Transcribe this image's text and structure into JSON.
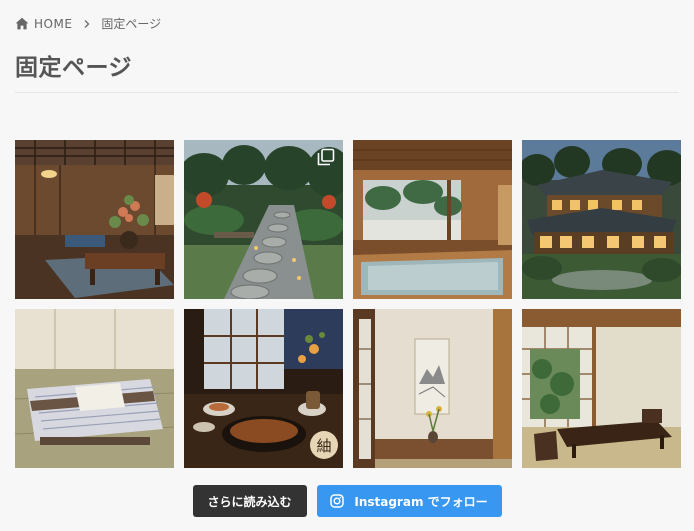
{
  "breadcrumb": {
    "home_icon": "home-icon",
    "home_label": "HOME",
    "separator_icon": "chevron-right-icon",
    "current_label": "固定ページ"
  },
  "page": {
    "title": "固定ページ"
  },
  "gallery": {
    "tiles": [
      {
        "subject": "traditional-japanese-living-room",
        "multi": false
      },
      {
        "subject": "japanese-garden-stone-path",
        "multi": true
      },
      {
        "subject": "indoor-hinoki-bath",
        "multi": false
      },
      {
        "subject": "ryokan-exterior-at-dusk",
        "multi": false
      },
      {
        "subject": "folded-yukata-on-tatami",
        "multi": false
      },
      {
        "subject": "kaiseki-meal-by-window",
        "multi": false
      },
      {
        "subject": "tokonoma-with-scroll",
        "multi": false
      },
      {
        "subject": "tatami-room-low-table",
        "multi": false
      }
    ],
    "multi_icon": "multiple-images-icon",
    "tile_seal_text": "紬"
  },
  "actions": {
    "load_more_label": "さらに読み込む",
    "follow_label": "Instagram でフォロー",
    "follow_icon": "instagram-icon"
  },
  "colors": {
    "background": "#f7f7f7",
    "title": "#555555",
    "load_more_bg": "#333333",
    "follow_bg": "#3897f0"
  }
}
